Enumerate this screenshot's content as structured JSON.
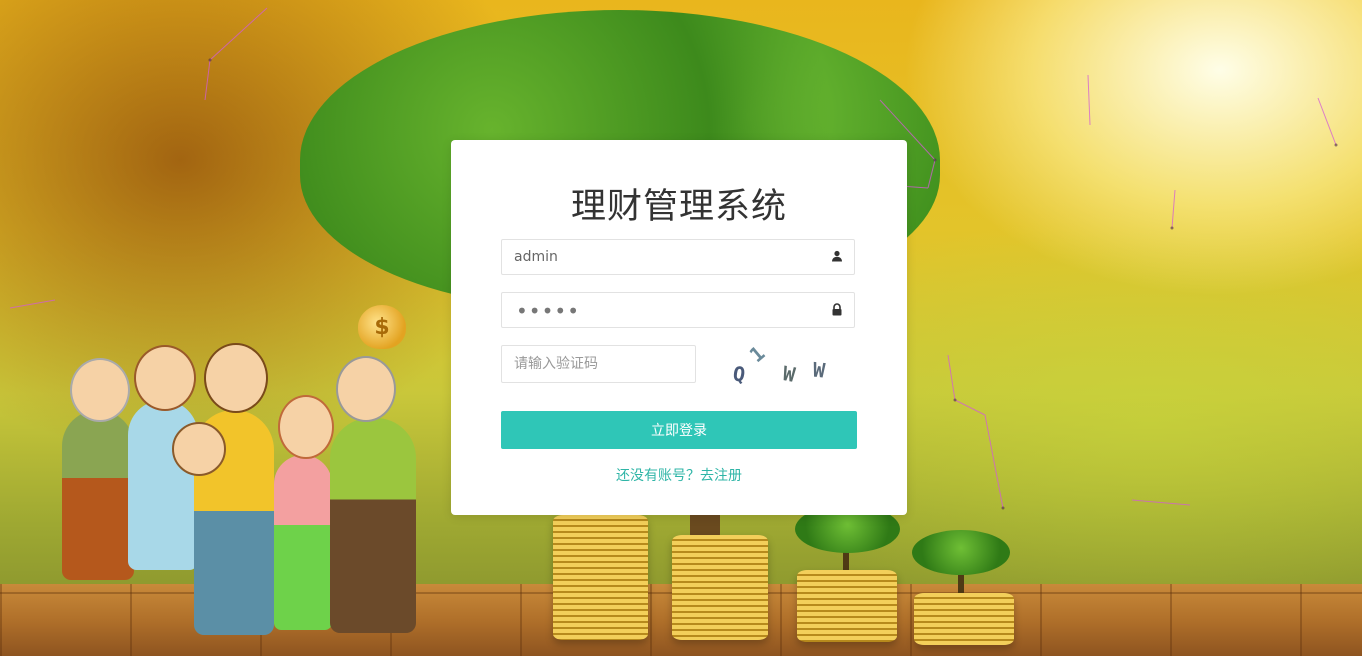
{
  "app": {
    "title": "理财管理系统"
  },
  "login_form": {
    "username_value": "admin",
    "password_value": "•••••",
    "captcha_placeholder": "请输入验证码",
    "captcha_chars": [
      "Q",
      "1",
      "W",
      "W"
    ],
    "submit_label": "立即登录",
    "register_link": "还没有账号？去注册"
  },
  "icons": {
    "username": "user-icon",
    "password": "lock-icon"
  },
  "colors": {
    "accent": "#2fc6b7",
    "link": "#2fb5a7",
    "card_bg": "#ffffff"
  }
}
